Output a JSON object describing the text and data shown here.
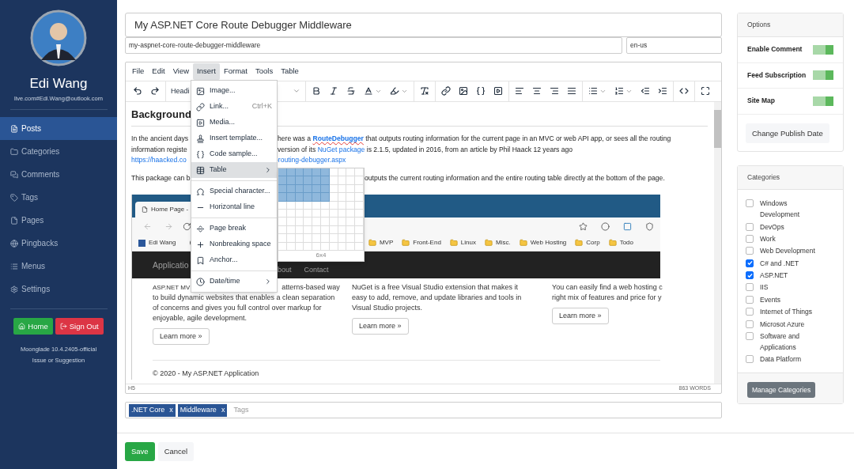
{
  "sidebar": {
    "user": {
      "name": "Edi Wang",
      "email": "live.com#Edi.Wang@outlook.com"
    },
    "nav": [
      {
        "label": "Posts",
        "selected": true
      },
      {
        "label": "Categories",
        "selected": false
      },
      {
        "label": "Comments",
        "selected": false
      },
      {
        "label": "Tags",
        "selected": false
      },
      {
        "label": "Pages",
        "selected": false
      },
      {
        "label": "Pingbacks",
        "selected": false
      },
      {
        "label": "Menus",
        "selected": false
      },
      {
        "label": "Settings",
        "selected": false
      }
    ],
    "buttons": [
      {
        "label": "Home",
        "kind": "home"
      },
      {
        "label": "Sign Out",
        "kind": "signout"
      }
    ],
    "version": "Moonglade 10.4.2405-official",
    "feedback_link": "Issue or Suggestion"
  },
  "post": {
    "title": "My ASP.NET Core Route Debugger Middleware",
    "slug": "my-aspnet-core-route-debugger-middleware",
    "language": "en-us"
  },
  "editor": {
    "menubar": [
      {
        "label": "File",
        "selected": false
      },
      {
        "label": "Edit",
        "selected": false
      },
      {
        "label": "View",
        "selected": false
      },
      {
        "label": "Insert",
        "selected": true
      },
      {
        "label": "Format",
        "selected": false
      },
      {
        "label": "Tools",
        "selected": false
      },
      {
        "label": "Table",
        "selected": false
      }
    ],
    "block_format": "Headi",
    "insert_menu": [
      [
        {
          "label": "Image...",
          "kind": "item",
          "selected": false
        },
        {
          "label": "Link...",
          "kind": "item",
          "selected": false,
          "shortcut": "Ctrl+K"
        },
        {
          "label": "Media...",
          "kind": "item",
          "selected": false
        },
        {
          "label": "Insert template...",
          "kind": "item",
          "selected": false
        },
        {
          "label": "Code sample...",
          "kind": "item",
          "selected": false
        },
        {
          "label": "Table",
          "kind": "submenu",
          "selected": true
        }
      ],
      [
        {
          "label": "Special character...",
          "kind": "item",
          "selected": false
        },
        {
          "label": "Horizontal line",
          "kind": "item",
          "selected": false
        }
      ],
      [
        {
          "label": "Page break",
          "kind": "item",
          "selected": false
        },
        {
          "label": "Nonbreaking space",
          "kind": "item",
          "selected": false
        },
        {
          "label": "Anchor...",
          "kind": "item",
          "selected": false
        }
      ],
      [
        {
          "label": "Date/time",
          "kind": "submenu",
          "selected": false
        }
      ]
    ],
    "table_picker": {
      "rows": [
        {
          "selected": [
            true,
            true,
            true,
            true,
            true,
            true,
            false,
            false,
            false,
            false
          ]
        },
        {
          "selected": [
            true,
            true,
            true,
            true,
            true,
            true,
            false,
            false,
            false,
            false
          ]
        },
        {
          "selected": [
            true,
            true,
            true,
            true,
            true,
            true,
            false,
            false,
            false,
            false
          ]
        },
        {
          "selected": [
            true,
            true,
            true,
            true,
            true,
            true,
            false,
            false,
            false,
            false
          ]
        },
        {
          "selected": [
            false,
            false,
            false,
            false,
            false,
            false,
            false,
            false,
            false,
            false
          ]
        },
        {
          "selected": [
            false,
            false,
            false,
            false,
            false,
            false,
            false,
            false,
            false,
            false
          ]
        },
        {
          "selected": [
            false,
            false,
            false,
            false,
            false,
            false,
            false,
            false,
            false,
            false
          ]
        },
        {
          "selected": [
            false,
            false,
            false,
            false,
            false,
            false,
            false,
            false,
            false,
            false
          ]
        },
        {
          "selected": [
            false,
            false,
            false,
            false,
            false,
            false,
            false,
            false,
            false,
            false
          ]
        },
        {
          "selected": [
            false,
            false,
            false,
            false,
            false,
            false,
            false,
            false,
            false,
            false
          ]
        }
      ],
      "size_label": "6x4"
    },
    "content": {
      "heading": "Background",
      "lines": [
        {
          "left": [
            {
              "kind": "text",
              "text": "In the ancient days"
            }
          ],
          "right": [
            {
              "kind": "text",
              "text": "here was a "
            },
            {
              "kind": "strong_link",
              "text": "RouteDebugger"
            },
            {
              "kind": "text",
              "text": " that outputs routing information for the current page in an MVC or web API app, or sees all the routing"
            }
          ]
        },
        {
          "left": [
            {
              "kind": "text",
              "text": "information registe"
            }
          ],
          "right": [
            {
              "kind": "text",
              "text": "version of its "
            },
            {
              "kind": "link",
              "text": "NuGet package"
            },
            {
              "kind": "text",
              "text": " is 2.1.5, updated in 2016, from an article by Phil Haack 12 years ago"
            }
          ]
        },
        {
          "left": [
            {
              "kind": "link",
              "text": "https://haacked.co"
            }
          ],
          "right": [
            {
              "kind": "link",
              "text": "-routing-debugger.aspx"
            }
          ]
        },
        {
          "left": [
            {
              "kind": "text",
              "text": "This package can b"
            }
          ],
          "right": [
            {
              "kind": "text",
              "text": "outputs the current routing information and the entire routing table directly at the bottom of the page."
            }
          ]
        }
      ],
      "screenshot": {
        "tab": "Home Page -",
        "bookmarks": [
          {
            "label": "Edi Wang",
            "kind": "site"
          },
          {
            "label": "MVP",
            "kind": "folder"
          },
          {
            "label": "Front-End",
            "kind": "folder"
          },
          {
            "label": "Linux",
            "kind": "folder"
          },
          {
            "label": "Misc.",
            "kind": "folder"
          },
          {
            "label": "Web Hosting",
            "kind": "folder"
          },
          {
            "label": "Corp",
            "kind": "folder"
          },
          {
            "label": "Todo",
            "kind": "folder"
          }
        ],
        "brand": "Applicatio",
        "nav": [
          "bout",
          "Contact"
        ],
        "columns": [
          {
            "lines": [
              {
                "text": "ASP.NET MV",
                "after_gap": "atterns-based way"
              },
              {
                "text": "to build dynamic websites that enables a clean separation"
              },
              {
                "text": "of concerns and gives you full control over markup for"
              },
              {
                "text": "enjoyable, agile development."
              }
            ],
            "button": "Learn more »"
          },
          {
            "lines": [
              {
                "text": "NuGet is a free Visual Studio extension that makes it"
              },
              {
                "text": "easy to add, remove, and update libraries and tools in"
              },
              {
                "text": "Visual Studio projects."
              }
            ],
            "button": "Learn more »"
          },
          {
            "lines": [
              {
                "text": "You can easily find a web hosting c"
              },
              {
                "text": "right mix of features and price for y"
              }
            ],
            "button": "Learn more »"
          }
        ],
        "footer": "© 2020 - My ASP.NET Application"
      }
    },
    "status_path": "H5",
    "word_count": "863 WORDS"
  },
  "tags": {
    "items": [
      {
        "label": ".NET Core",
        "remove": "x"
      },
      {
        "label": "Middleware",
        "remove": "x"
      }
    ],
    "placeholder": "Tags"
  },
  "actions": [
    {
      "label": "Save",
      "kind": "primary"
    },
    {
      "label": "Cancel",
      "kind": "secondary"
    }
  ],
  "options": {
    "title": "Options",
    "toggles": [
      {
        "label": "Enable Comment",
        "on": true
      },
      {
        "label": "Feed Subscription",
        "on": true
      },
      {
        "label": "Site Map",
        "on": true
      }
    ],
    "button": "Change Publish Date"
  },
  "categories": {
    "title": "Categories",
    "items": [
      {
        "label": "Windows Development",
        "checked": false
      },
      {
        "label": "DevOps",
        "checked": false
      },
      {
        "label": "Work",
        "checked": false
      },
      {
        "label": "Web Development",
        "checked": false
      },
      {
        "label": "C# and .NET",
        "checked": true
      },
      {
        "label": "ASP.NET",
        "checked": true
      },
      {
        "label": "IIS",
        "checked": false
      },
      {
        "label": "Events",
        "checked": false
      },
      {
        "label": "Internet of Things",
        "checked": false
      },
      {
        "label": "Microsot Azure",
        "checked": false
      },
      {
        "label": "Software and Applications",
        "checked": false
      },
      {
        "label": "Data Platform",
        "checked": false
      }
    ],
    "button": "Manage Categories"
  }
}
